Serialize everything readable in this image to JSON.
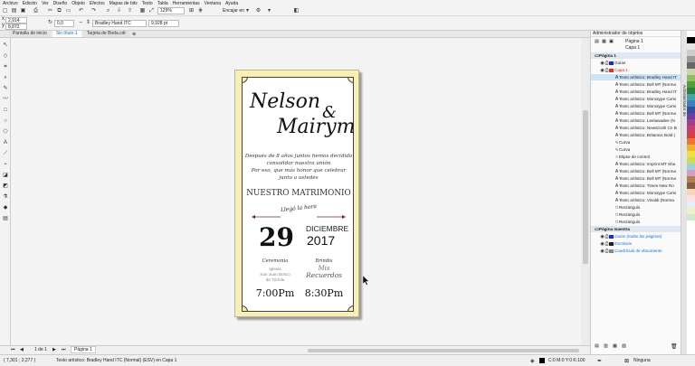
{
  "menu": [
    "Archivo",
    "Edición",
    "Ver",
    "Diseño",
    "Objeto",
    "Efectos",
    "Mapas de bits",
    "Texto",
    "Tabla",
    "Herramientas",
    "Ventana",
    "Ayuda"
  ],
  "toolbar": {
    "zoom": "129%",
    "snap_label": "Encajar en",
    "x_value": "2,914 cm",
    "y_value": "8,872 cm",
    "angle_value": "0,0",
    "font_name": "Bradley Hand ITC",
    "font_size": "9,928 pt"
  },
  "tabs": [
    "Pantalla de inicio",
    "Sin título-1",
    "Tarjeta de Boda.cdr"
  ],
  "card": {
    "name1": "Nelson",
    "ampersand": "&",
    "name2": "Mairym",
    "line1": "Después de 8 años juntos hemos decidido",
    "line2": "consolidar nuestra unión",
    "line3": "Por eso, que más honor que celebrar",
    "line4": "junto a ustedes",
    "heading": "NUESTRO MATRIMONIO",
    "arc": "Llegó la hora",
    "day": "29",
    "month": "DICIEMBRE",
    "year": "2017",
    "label_left": "Ceremonia",
    "label_right": "Brindis",
    "place_left_1": "Iglesia",
    "place_left_2": "San Juan Bosco",
    "place_left_3": "de Tórtola",
    "place_right_1": "Mis",
    "place_right_2": "Recuerdos",
    "time_left": "7:00Pm",
    "time_right": "8:30Pm"
  },
  "page_nav": {
    "page_counter": "1 de 1",
    "page_tab": "Página 1"
  },
  "status": {
    "coords": "( 7,301 ; 2,277 )",
    "object_info": "Texto artístico: Bradley Hand ITC (Normal) (ESV) en Capa 1",
    "fill_info": "C:0 M:0 Y:0 K:100",
    "outline_info": "Ninguna"
  },
  "object_manager": {
    "title": "Administrador de objetos",
    "page_label": "Página 1",
    "layer_label": "Capa 1",
    "dock_label": "Administrador de",
    "rows": [
      {
        "text": "Página 1",
        "kind": "heading"
      },
      {
        "text": "Guías",
        "kind": "layer",
        "color": "#1a2bd6"
      },
      {
        "text": "Capa 1",
        "kind": "layer-red",
        "color": "#e03030"
      },
      {
        "text": "Texto artístico: Bradley Hand IT",
        "kind": "sel"
      },
      {
        "text": "Texto artístico: Bell MT (Norma",
        "kind": "item"
      },
      {
        "text": "Texto artístico: Bradley Hand IT",
        "kind": "item"
      },
      {
        "text": "Texto artístico: Monotype Corsi",
        "kind": "item"
      },
      {
        "text": "Texto artístico: Monotype Corsi",
        "kind": "item"
      },
      {
        "text": "Texto artístico: Bell MT (Norma",
        "kind": "item"
      },
      {
        "text": "Texto artístico: Leelawadee (N",
        "kind": "item"
      },
      {
        "text": "Texto artístico: NewsGoth Cn B",
        "kind": "item"
      },
      {
        "text": "Texto artístico: Britannic Bold (",
        "kind": "item"
      },
      {
        "text": "Curva",
        "kind": "curve"
      },
      {
        "text": "Curva",
        "kind": "curve"
      },
      {
        "text": "Elipse de control",
        "kind": "ellipse"
      },
      {
        "text": "Texto artístico: Imprint MT Sha",
        "kind": "item"
      },
      {
        "text": "Texto artístico: Bell MT (Norma",
        "kind": "item"
      },
      {
        "text": "Texto artístico: Bell MT (Norma",
        "kind": "item"
      },
      {
        "text": "Texto artístico: Times New Ro",
        "kind": "item"
      },
      {
        "text": "Texto artístico: Monotype Corsi",
        "kind": "item"
      },
      {
        "text": "Texto artístico: Vivaldi (Norma",
        "kind": "item"
      },
      {
        "text": "Rectángulo",
        "kind": "rect"
      },
      {
        "text": "Rectángulo",
        "kind": "rect"
      },
      {
        "text": "Rectángulo",
        "kind": "rect"
      },
      {
        "text": "Página maestra",
        "kind": "heading"
      },
      {
        "text": "Guías (todas las páginas)",
        "kind": "master",
        "color": "#1a2bd6"
      },
      {
        "text": "Escritorio",
        "kind": "master",
        "color": "#222222"
      },
      {
        "text": "Cuadrícula de documento",
        "kind": "master",
        "color": "#888888"
      }
    ]
  },
  "palette": [
    "#ffffff",
    "#000000",
    "#e6e6e6",
    "#cccccc",
    "#999999",
    "#666666",
    "#c8d7a8",
    "#8fbf5f",
    "#4f9f3f",
    "#2f7f3f",
    "#3fa7a7",
    "#3f7fbf",
    "#2f4f9f",
    "#6f3f9f",
    "#9f3f8f",
    "#c83f6f",
    "#d84040",
    "#e87a30",
    "#f0b030",
    "#f0e040",
    "#c8e050",
    "#a0d0e0",
    "#d0a0c0",
    "#b08050",
    "#806040",
    "#f5d7b0",
    "#ffe0e0",
    "#e0f0ff",
    "#f0f0c0",
    "#d0e8d0"
  ],
  "colors": {
    "page_bg": "#f8efb5",
    "selection": "#cfe3f7",
    "accent": "#1a6ec8"
  }
}
